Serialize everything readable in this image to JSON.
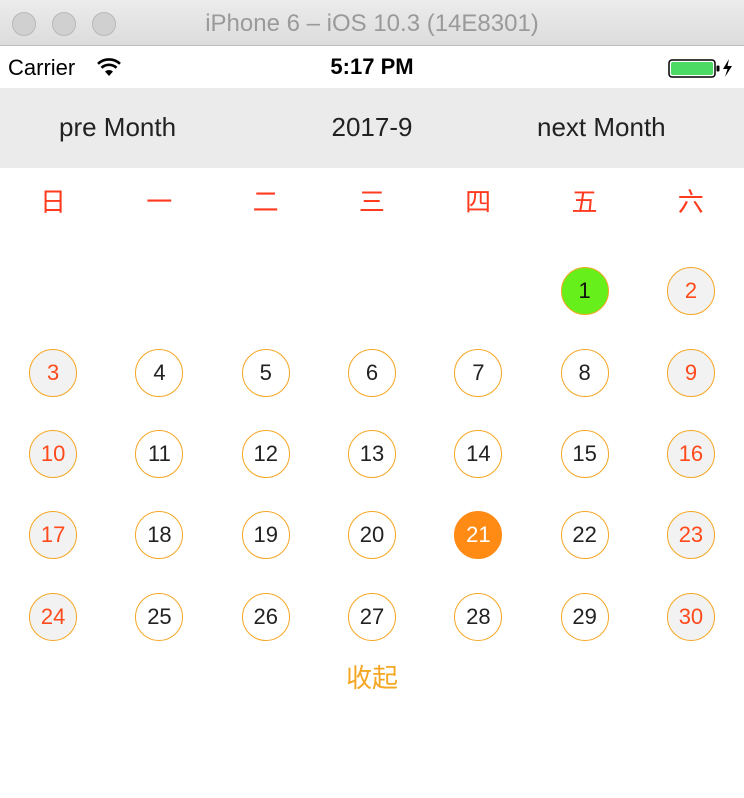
{
  "window": {
    "title": "iPhone 6 – iOS 10.3 (14E8301)"
  },
  "status_bar": {
    "carrier": "Carrier",
    "time": "5:17 PM"
  },
  "nav": {
    "prev_label": "pre Month",
    "title": "2017-9",
    "next_label": "next Month"
  },
  "weekdays": [
    "日",
    "一",
    "二",
    "三",
    "四",
    "五",
    "六"
  ],
  "calendar": {
    "first_weekday": 5,
    "days": [
      "1",
      "2",
      "3",
      "4",
      "5",
      "6",
      "7",
      "8",
      "9",
      "10",
      "11",
      "12",
      "13",
      "14",
      "15",
      "16",
      "17",
      "18",
      "19",
      "20",
      "21",
      "22",
      "23",
      "24",
      "25",
      "26",
      "27",
      "28",
      "29",
      "30"
    ],
    "selected_day": "1",
    "today_day": "21"
  },
  "collapse_label": "收起",
  "colors": {
    "weekday_text": "#ff3b1f",
    "weekend_text": "#ff4a1c",
    "circle_border": "#f5a623",
    "selected_fill": "#66ef1a",
    "today_fill": "#ff8a14",
    "collapse_text": "#f5a623"
  },
  "icons": {
    "wifi": "wifi-icon",
    "battery": "battery-charging-icon"
  }
}
